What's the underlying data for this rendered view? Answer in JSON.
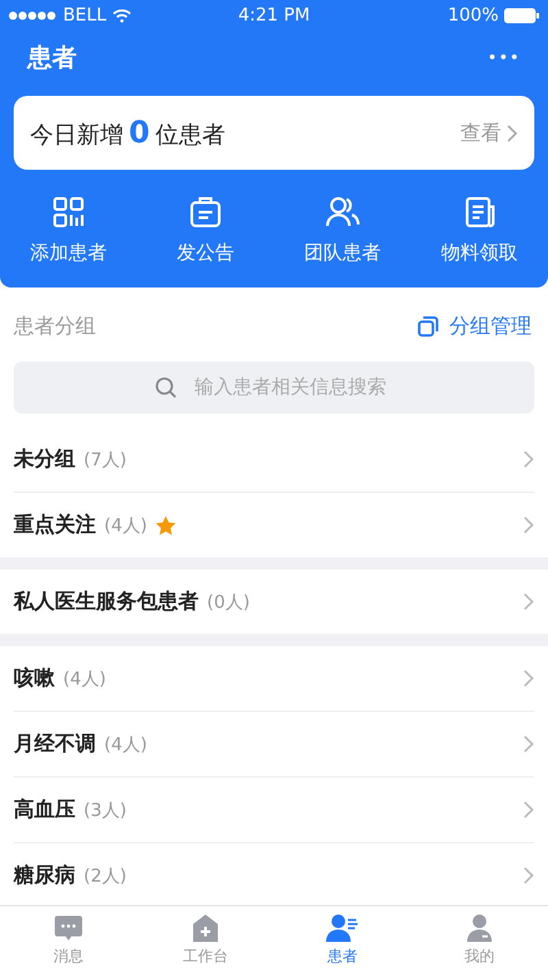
{
  "status_bar": {
    "carrier": "BELL",
    "time": "4:21 PM",
    "battery": "100%"
  },
  "header": {
    "title": "患者",
    "more": "•••"
  },
  "summary": {
    "prefix": "今日新增",
    "count": "0",
    "suffix": "位患者",
    "link": "查看"
  },
  "actions": [
    {
      "kind": "grid",
      "label": "添加患者"
    },
    {
      "kind": "notice",
      "label": "发公告"
    },
    {
      "kind": "team",
      "label": "团队患者"
    },
    {
      "kind": "doc",
      "label": "物料领取"
    }
  ],
  "section": {
    "title": "患者分组",
    "manage": "分组管理"
  },
  "search": {
    "placeholder": "输入患者相关信息搜索"
  },
  "groups": [
    {
      "items": [
        {
          "name": "未分组",
          "count": "(7人)",
          "starred": false
        },
        {
          "name": "重点关注",
          "count": "(4人)",
          "starred": true
        }
      ]
    },
    {
      "items": [
        {
          "name": "私人医生服务包患者",
          "count": "(0人)",
          "starred": false
        }
      ]
    },
    {
      "items": [
        {
          "name": "咳嗽",
          "count": "(4人)",
          "starred": false
        },
        {
          "name": "月经不调",
          "count": "(4人)",
          "starred": false
        },
        {
          "name": "高血压",
          "count": "(3人)",
          "starred": false
        },
        {
          "name": "糖尿病",
          "count": "(2人)",
          "starred": false
        }
      ]
    }
  ],
  "tabs": [
    {
      "kind": "chat",
      "label": "消息",
      "selected": false
    },
    {
      "kind": "work",
      "label": "工作台",
      "selected": false
    },
    {
      "kind": "patient",
      "label": "患者",
      "selected": true
    },
    {
      "kind": "me",
      "label": "我的",
      "selected": false
    }
  ]
}
